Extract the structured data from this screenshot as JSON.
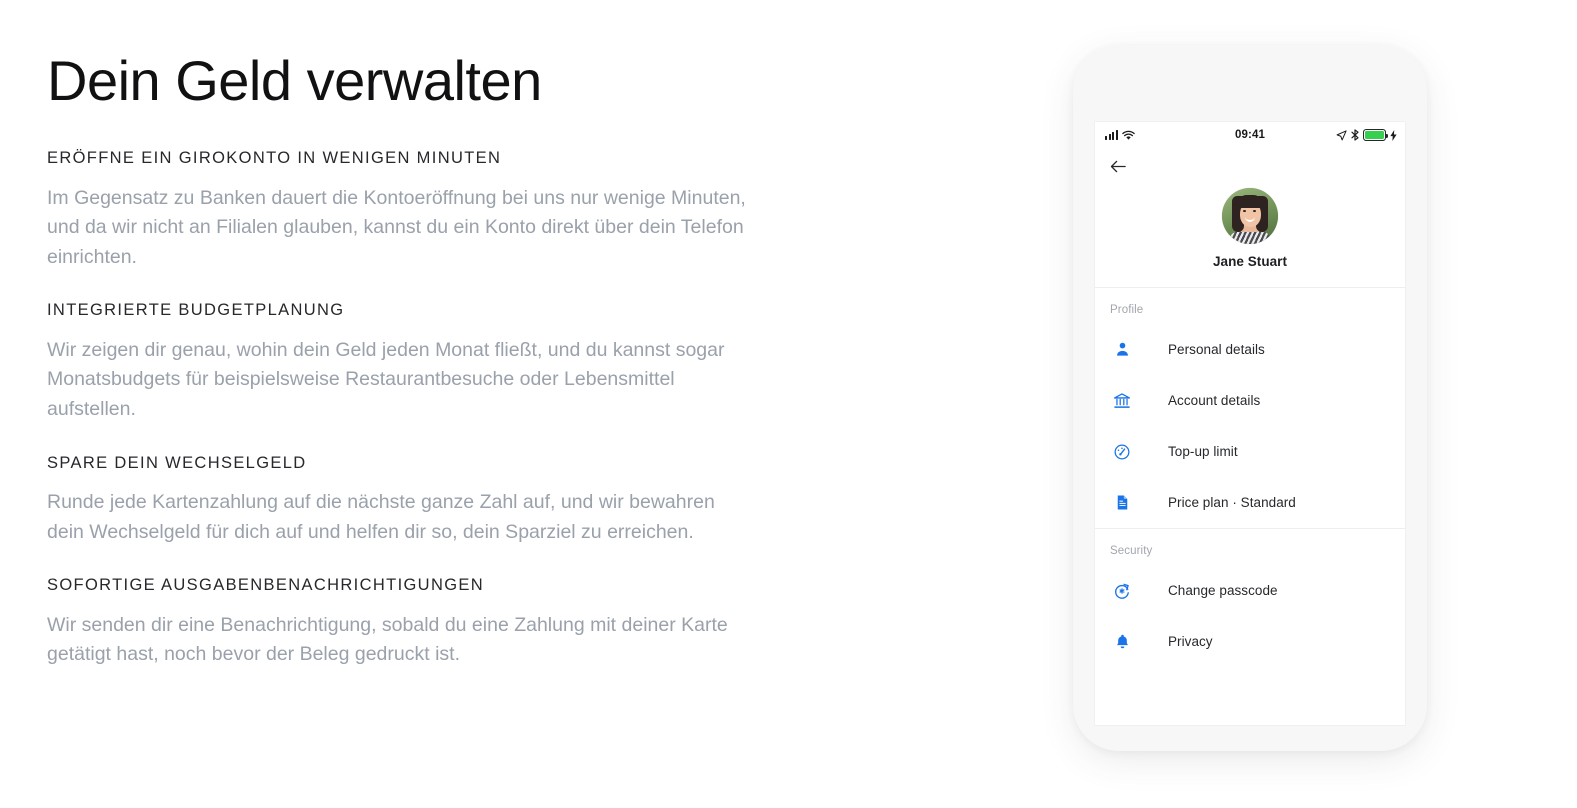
{
  "headline": "Dein Geld verwalten",
  "features": [
    {
      "title": "ERÖFFNE EIN GIROKONTO IN WENIGEN MINUTEN",
      "body": "Im Gegensatz zu Banken dauert die Kontoeröffnung bei uns nur wenige Minuten, und da wir nicht an Filialen glauben, kannst du ein Konto direkt über dein Telefon einrichten."
    },
    {
      "title": "INTEGRIERTE BUDGETPLANUNG",
      "body": "Wir zeigen dir genau, wohin dein Geld jeden Monat fließt, und du kannst sogar Monatsbudgets für beispielsweise Restaurantbesuche oder Lebensmittel aufstellen."
    },
    {
      "title": "SPARE DEIN WECHSELGELD",
      "body": "Runde jede Kartenzahlung auf die nächste ganze Zahl auf, und wir bewahren dein Wechselgeld für dich auf und helfen dir so, dein Sparziel zu erreichen."
    },
    {
      "title": "SOFORTIGE AUSGABENBENACHRICHTIGUNGEN",
      "body": "Wir senden dir eine Benachrichtigung, sobald du eine Zahlung mit deiner Karte getätigt hast, noch bevor der Beleg gedruckt ist."
    }
  ],
  "phone": {
    "status_bar": {
      "time": "09:41",
      "signal_icon": "cellular-signal-icon",
      "wifi_icon": "wifi-icon",
      "location_icon": "location-arrow-icon",
      "bluetooth_icon": "bluetooth-icon",
      "battery_icon": "battery-icon",
      "charging_icon": "charging-bolt-icon",
      "battery_color": "#35d04f"
    },
    "nav": {
      "back_icon": "back-arrow-icon"
    },
    "profile": {
      "avatar_icon": "user-avatar-photo",
      "name": "Jane Stuart"
    },
    "sections": [
      {
        "label": "Profile",
        "items": [
          {
            "label": "Personal details",
            "icon": "person-icon"
          },
          {
            "label": "Account details",
            "icon": "bank-icon"
          },
          {
            "label": "Top-up limit",
            "icon": "speedometer-icon"
          },
          {
            "label": "Price plan · Standard",
            "icon": "document-icon"
          }
        ]
      },
      {
        "label": "Security",
        "items": [
          {
            "label": "Change passcode",
            "icon": "reset-passcode-icon"
          },
          {
            "label": "Privacy",
            "icon": "bell-icon"
          }
        ]
      }
    ],
    "accent_color": "#1a73e8",
    "body_color": "#26282c",
    "muted_color": "#a2a6ad"
  }
}
